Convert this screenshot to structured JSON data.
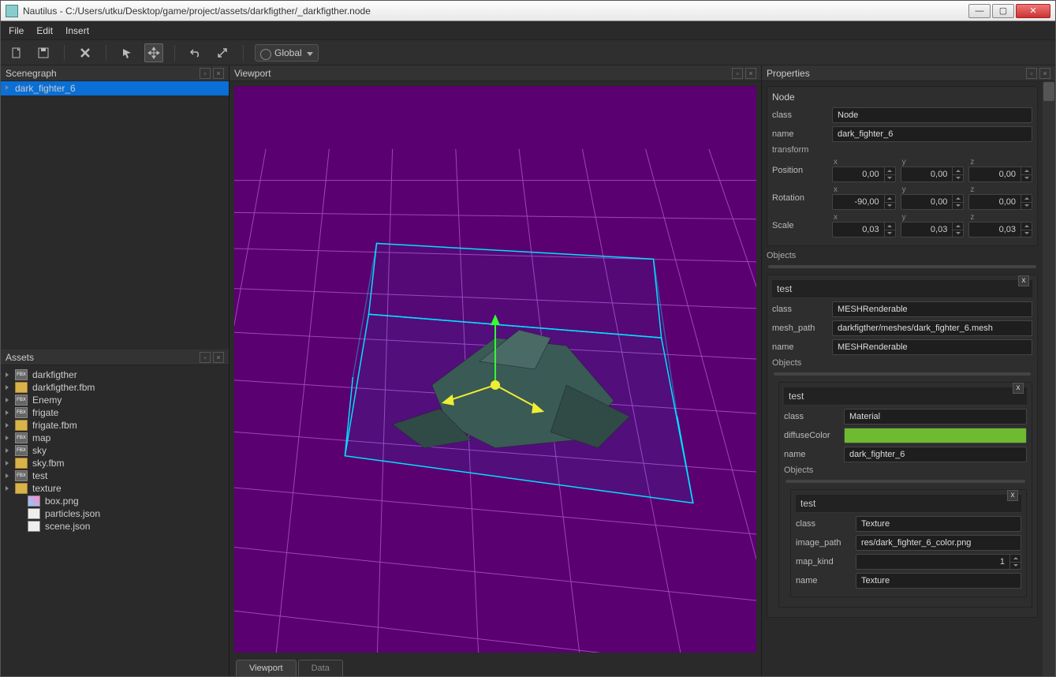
{
  "titlebar": {
    "text": "Nautilus - C:/Users/utku/Desktop/game/project/assets/darkfigther/_darkfigther.node"
  },
  "menubar": {
    "file": "File",
    "edit": "Edit",
    "insert": "Insert"
  },
  "toolbar": {
    "global": "Global"
  },
  "panels": {
    "scenegraph": "Scenegraph",
    "assets": "Assets",
    "viewport": "Viewport",
    "properties": "Properties"
  },
  "scenegraph": {
    "item": "dark_fighter_6"
  },
  "assets": {
    "items": [
      {
        "name": "darkfigther",
        "icon": "fbx",
        "caret": true,
        "indent": 0
      },
      {
        "name": "darkfigther.fbm",
        "icon": "folder",
        "caret": true,
        "indent": 0
      },
      {
        "name": "Enemy",
        "icon": "fbx",
        "caret": true,
        "indent": 0
      },
      {
        "name": "frigate",
        "icon": "fbx",
        "caret": true,
        "indent": 0
      },
      {
        "name": "frigate.fbm",
        "icon": "folder",
        "caret": true,
        "indent": 0
      },
      {
        "name": "map",
        "icon": "fbx",
        "caret": true,
        "indent": 0
      },
      {
        "name": "sky",
        "icon": "fbx",
        "caret": true,
        "indent": 0
      },
      {
        "name": "sky.fbm",
        "icon": "folder",
        "caret": true,
        "indent": 0
      },
      {
        "name": "test",
        "icon": "fbx",
        "caret": true,
        "indent": 0
      },
      {
        "name": "texture",
        "icon": "folder",
        "caret": true,
        "indent": 0
      },
      {
        "name": "box.png",
        "icon": "img",
        "caret": false,
        "indent": 1
      },
      {
        "name": "particles.json",
        "icon": "json",
        "caret": false,
        "indent": 1
      },
      {
        "name": "scene.json",
        "icon": "json",
        "caret": false,
        "indent": 1
      }
    ]
  },
  "viewport_tabs": {
    "active": "Viewport",
    "inactive": "Data"
  },
  "properties": {
    "node": {
      "title": "Node",
      "class_label": "class",
      "class_value": "Node",
      "name_label": "name",
      "name_value": "dark_fighter_6",
      "transform_label": "transform",
      "position_label": "Position",
      "position": {
        "x": "0,00",
        "y": "0,00",
        "z": "0,00"
      },
      "rotation_label": "Rotation",
      "rotation": {
        "x": "-90,00",
        "y": "0,00",
        "z": "0,00"
      },
      "scale_label": "Scale",
      "scale": {
        "x": "0,03",
        "y": "0,03",
        "z": "0,03"
      },
      "axes": {
        "x": "x",
        "y": "y",
        "z": "z"
      }
    },
    "objects_label": "Objects",
    "test_label": "test",
    "mesh": {
      "class_label": "class",
      "class_value": "MESHRenderable",
      "meshpath_label": "mesh_path",
      "meshpath_value": "darkfigther/meshes/dark_fighter_6.mesh",
      "name_label": "name",
      "name_value": "MESHRenderable"
    },
    "material": {
      "class_label": "class",
      "class_value": "Material",
      "diffuse_label": "diffuseColor",
      "diffuse_color": "#6dbb2f",
      "name_label": "name",
      "name_value": "dark_fighter_6"
    },
    "texture": {
      "class_label": "class",
      "class_value": "Texture",
      "imagepath_label": "image_path",
      "imagepath_value": "res/dark_fighter_6_color.png",
      "mapkind_label": "map_kind",
      "mapkind_value": "1",
      "name_label": "name",
      "name_value": "Texture"
    }
  }
}
